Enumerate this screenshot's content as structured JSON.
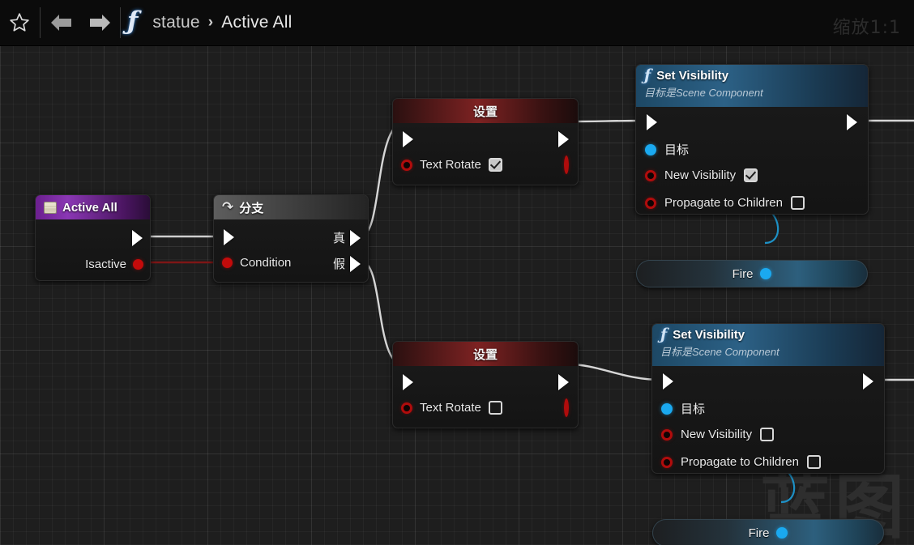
{
  "toolbar": {
    "favorite_icon": "star-icon",
    "back_icon": "arrow-left-icon",
    "forward_icon": "arrow-right-icon",
    "function_icon": "function-f-icon",
    "breadcrumb_root": "statue",
    "breadcrumb_separator": "›",
    "breadcrumb_current": "Active All",
    "zoom_label": "缩放1:1"
  },
  "canvas": {
    "watermark": "蓝图"
  },
  "nodes": {
    "active_all": {
      "title": "Active All",
      "icon": "event-node-icon",
      "exec_out_icon": "exec-out-pin",
      "output_label": "Isactive",
      "output_pin_icon": "bool-pin-red"
    },
    "branch": {
      "title": "分支",
      "icon": "branch-icon",
      "exec_in_icon": "exec-in-pin",
      "condition_label": "Condition",
      "condition_pin_icon": "bool-pin-red",
      "true_label": "真",
      "false_label": "假",
      "true_pin_icon": "exec-out-pin",
      "false_pin_icon": "exec-out-pin"
    },
    "set_top": {
      "title": "设置",
      "exec_in_icon": "exec-in-pin",
      "exec_out_icon": "exec-out-pin",
      "property_label": "Text Rotate",
      "property_checked": true,
      "in_pin_icon": "bool-pin-red-hollow",
      "out_pin_icon": "bool-pin-red-hollow"
    },
    "set_bottom": {
      "title": "设置",
      "exec_in_icon": "exec-in-pin",
      "exec_out_icon": "exec-out-pin",
      "property_label": "Text Rotate",
      "property_checked": false,
      "in_pin_icon": "bool-pin-red-hollow",
      "out_pin_icon": "bool-pin-red-hollow"
    },
    "set_visibility_top": {
      "title": "Set Visibility",
      "subtitle": "目标是Scene Component",
      "icon": "function-f-icon",
      "exec_in_icon": "exec-in-pin",
      "exec_out_icon": "exec-out-pin",
      "target_label": "目标",
      "target_pin_icon": "object-pin-blue",
      "new_visibility_label": "New Visibility",
      "new_visibility_checked": true,
      "new_visibility_pin_icon": "bool-pin-red-hollow",
      "propagate_label": "Propagate to Children",
      "propagate_checked": false,
      "propagate_pin_icon": "bool-pin-red-hollow",
      "fire_label": "Fire",
      "fire_pin_icon": "object-pin-blue"
    },
    "set_visibility_bottom": {
      "title": "Set Visibility",
      "subtitle": "目标是Scene Component",
      "icon": "function-f-icon",
      "exec_in_icon": "exec-in-pin",
      "exec_out_icon": "exec-out-pin",
      "target_label": "目标",
      "target_pin_icon": "object-pin-blue",
      "new_visibility_label": "New Visibility",
      "new_visibility_checked": false,
      "new_visibility_pin_icon": "bool-pin-red-hollow",
      "propagate_label": "Propagate to Children",
      "propagate_checked": false,
      "propagate_pin_icon": "bool-pin-red-hollow",
      "fire_label": "Fire",
      "fire_pin_icon": "object-pin-blue"
    }
  },
  "colors": {
    "exec_wire": "#d8d8d8",
    "bool_wire": "#7a1414",
    "object_wire": "#1d9ad4",
    "event_header": "#8a37b4",
    "function_header": "#2d6387",
    "set_header": "#7d2222",
    "bool_pin": "#c40b0b",
    "object_pin": "#1aa9f0"
  }
}
